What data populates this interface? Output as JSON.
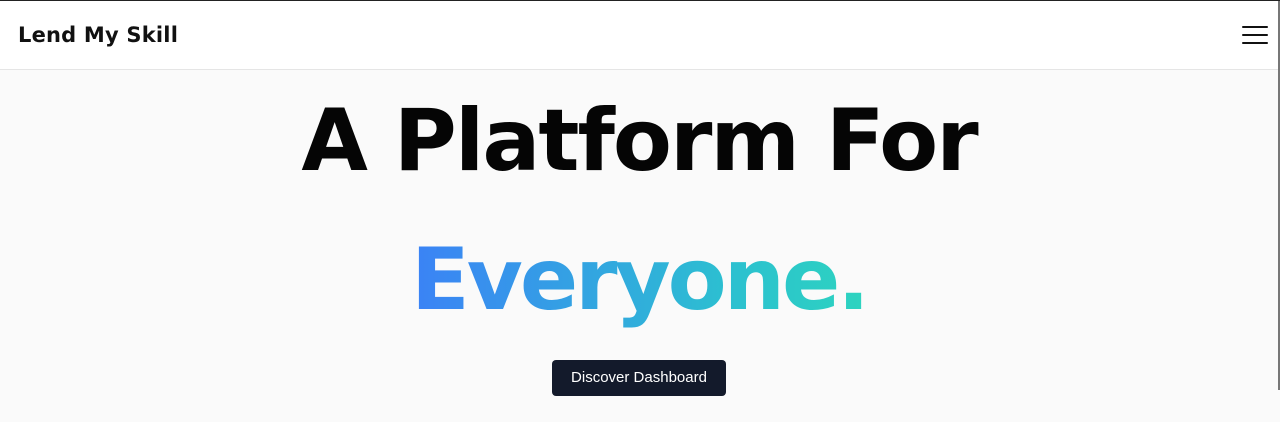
{
  "navbar": {
    "brand": "Lend My Skill",
    "menu_icon": "hamburger-menu-icon"
  },
  "hero": {
    "headline_line1": "A Platform For",
    "headline_line2": "Everyone.",
    "cta_label": "Discover Dashboard"
  },
  "colors": {
    "gradient_start": "#3b82f6",
    "gradient_end": "#2dd4bf",
    "cta_background": "#131a2b",
    "page_background": "#fafafa"
  }
}
